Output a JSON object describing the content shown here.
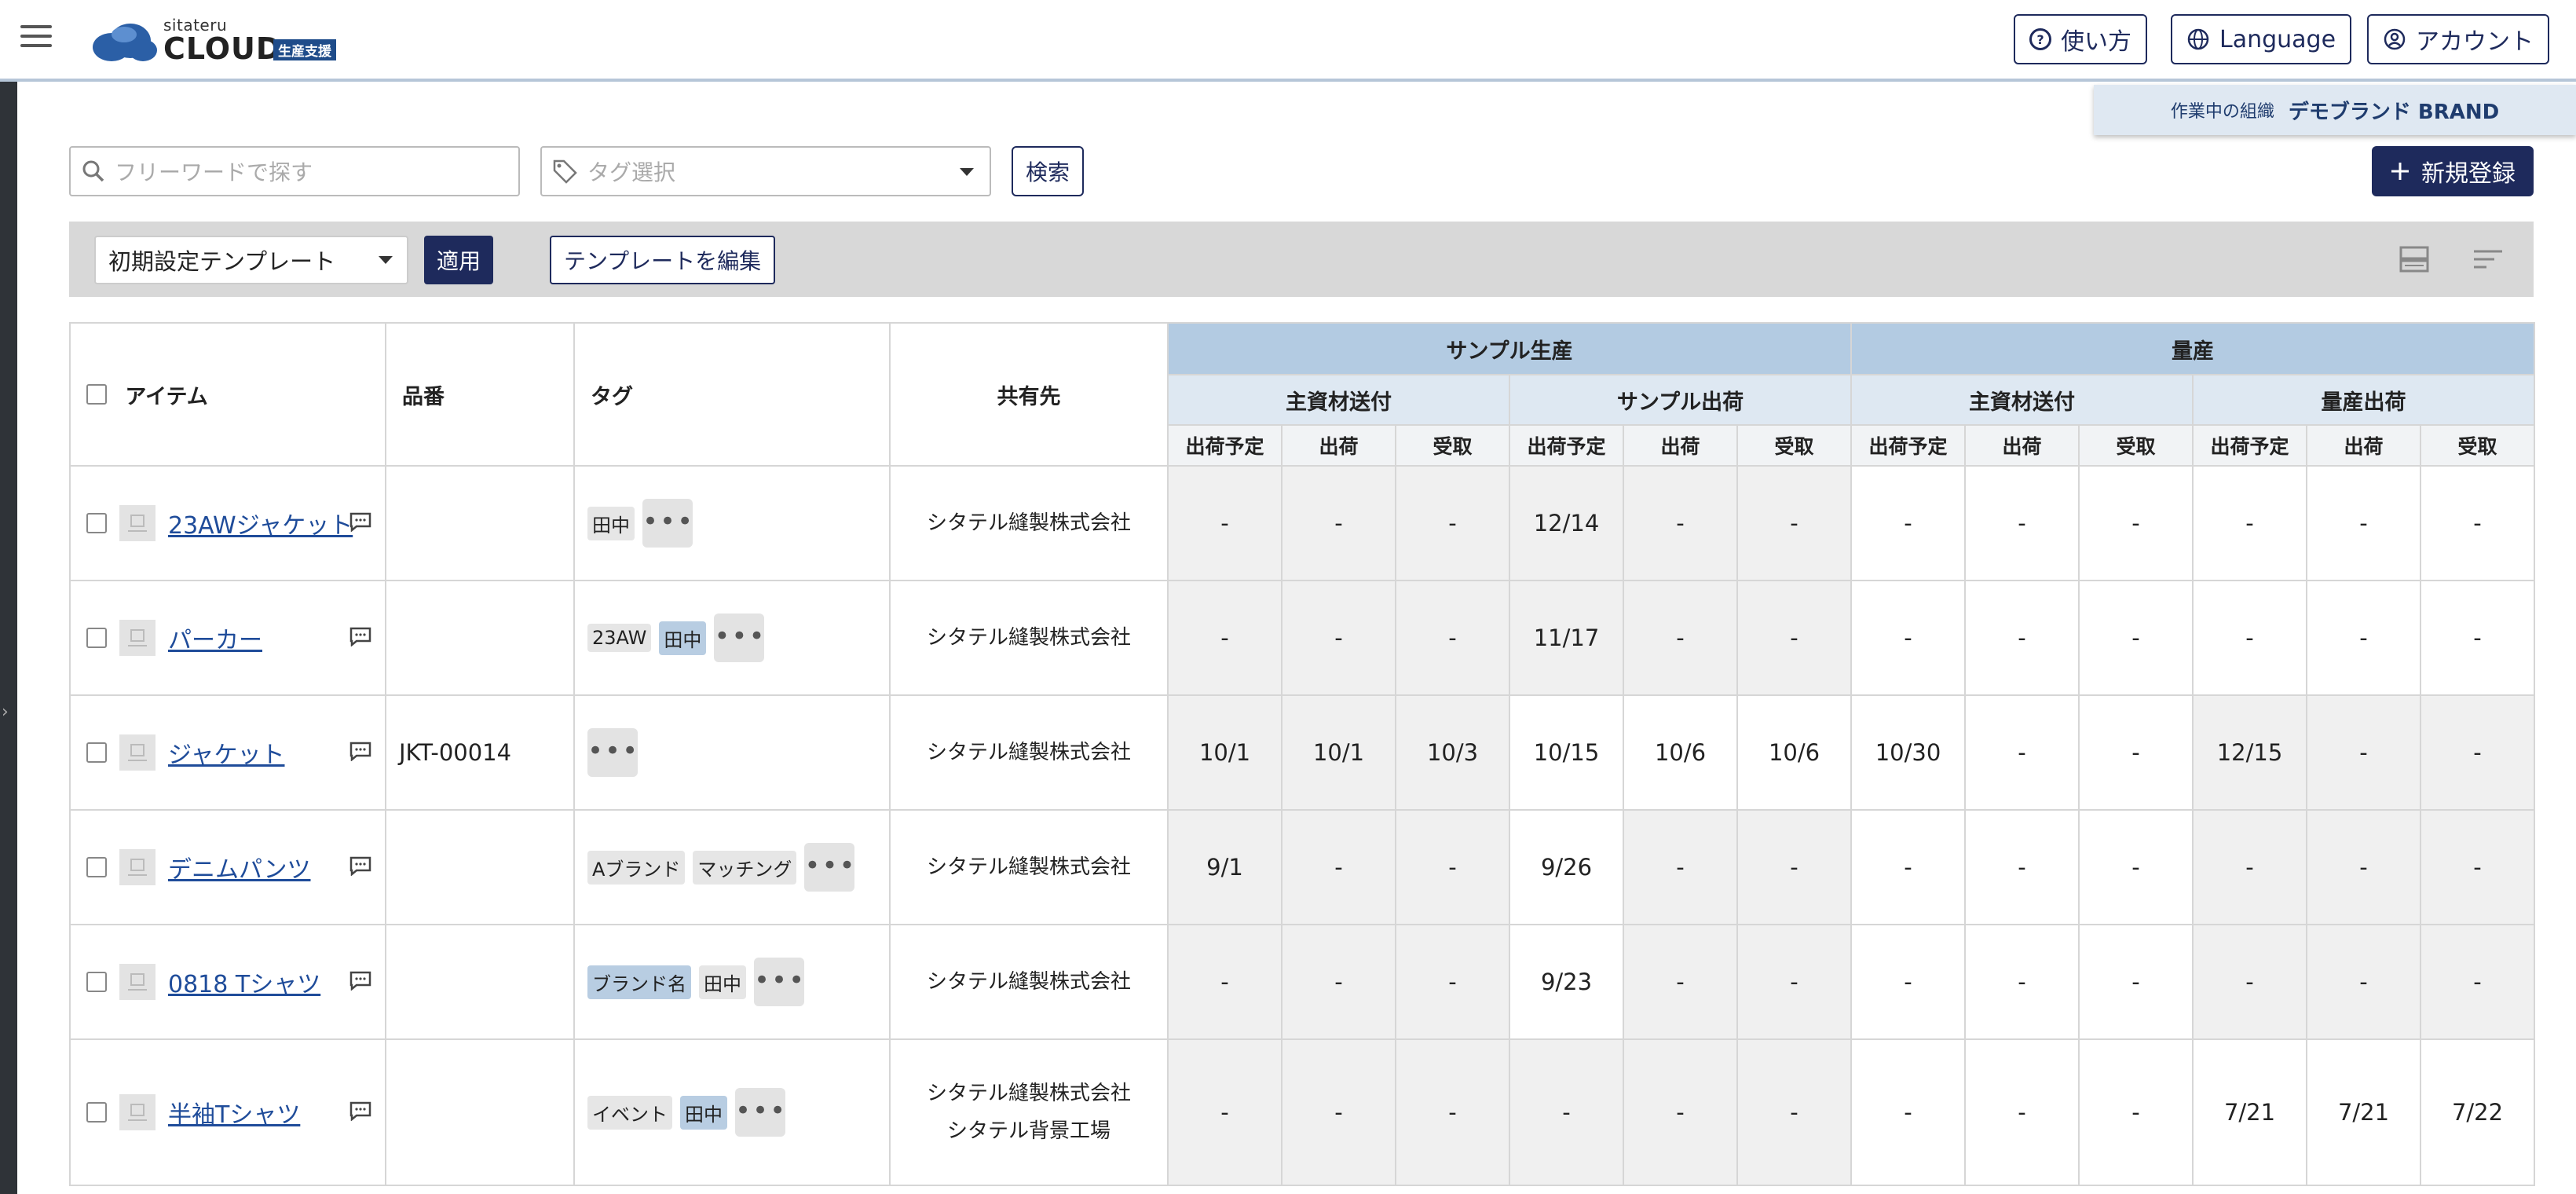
{
  "header": {
    "logo_sub": "sitateru",
    "logo_main": "CLOUD",
    "logo_badge": "生産支援",
    "help_label": "使い方",
    "language_label": "Language",
    "account_label": "アカウント"
  },
  "org": {
    "label": "作業中の組織",
    "name": "デモブランド BRAND"
  },
  "search": {
    "placeholder": "フリーワードで探す",
    "tag_placeholder": "タグ選択",
    "button": "検索"
  },
  "new_button": "新規登録",
  "toolbar": {
    "template": "初期設定テンプレート",
    "apply": "適用",
    "edit_template": "テンプレートを編集"
  },
  "table": {
    "col_item": "アイテム",
    "col_code": "品番",
    "col_tag": "タグ",
    "col_share": "共有先",
    "group_sample": "サンプル生産",
    "group_mass": "量産",
    "sub_material1": "主資材送付",
    "sub_sample_ship": "サンプル出荷",
    "sub_material2": "主資材送付",
    "sub_mass_ship": "量産出荷",
    "h_plan": "出荷予定",
    "h_ship": "出荷",
    "h_recv": "受取",
    "rows": [
      {
        "name": "23AWジャケット",
        "code": "",
        "share1": "シタテル縫製株式会社",
        "share2": "",
        "v": [
          "-",
          "-",
          "-",
          "12/14",
          "-",
          "-",
          "-",
          "-",
          "-",
          "-",
          "-",
          "-"
        ]
      },
      {
        "name": "パーカー",
        "code": "",
        "share1": "シタテル縫製株式会社",
        "share2": "",
        "v": [
          "-",
          "-",
          "-",
          "11/17",
          "-",
          "-",
          "-",
          "-",
          "-",
          "-",
          "-",
          "-"
        ]
      },
      {
        "name": "ジャケット",
        "code": "JKT-00014",
        "share1": "シタテル縫製株式会社",
        "share2": "",
        "v": [
          "10/1",
          "10/1",
          "10/3",
          "10/15",
          "10/6",
          "10/6",
          "10/30",
          "-",
          "-",
          "12/15",
          "-",
          "-"
        ]
      },
      {
        "name": "デニムパンツ",
        "code": "",
        "share1": "シタテル縫製株式会社",
        "share2": "",
        "v": [
          "9/1",
          "-",
          "-",
          "9/26",
          "-",
          "-",
          "-",
          "-",
          "-",
          "-",
          "-",
          "-"
        ]
      },
      {
        "name": "0818 Tシャツ",
        "code": "",
        "share1": "シタテル縫製株式会社",
        "share2": "",
        "v": [
          "-",
          "-",
          "-",
          "9/23",
          "-",
          "-",
          "-",
          "-",
          "-",
          "-",
          "-",
          "-"
        ]
      },
      {
        "name": "半袖Tシャツ",
        "code": "",
        "share1": "シタテル縫製株式会社",
        "share2": "シタテル背景工場",
        "v": [
          "-",
          "-",
          "-",
          "-",
          "-",
          "-",
          "-",
          "-",
          "-",
          "7/21",
          "7/21",
          "7/22"
        ]
      }
    ],
    "tags": [
      [
        {
          "t": "田中",
          "c": "gray"
        }
      ],
      [
        {
          "t": "23AW",
          "c": "gray"
        },
        {
          "t": "田中",
          "c": "blue"
        }
      ],
      [],
      [
        {
          "t": "Aブランド",
          "c": "gray"
        },
        {
          "t": "マッチング",
          "c": "gray"
        }
      ],
      [
        {
          "t": "ブランド名",
          "c": "blue"
        },
        {
          "t": "田中",
          "c": "gray"
        }
      ],
      [
        {
          "t": "イベント",
          "c": "gray"
        },
        {
          "t": "田中",
          "c": "blue"
        }
      ]
    ]
  },
  "colors": {
    "accent": "#1e2a5c",
    "group_header": "#b3cbe2",
    "sub_header": "#dee8f2",
    "link": "#1f4c9a"
  }
}
